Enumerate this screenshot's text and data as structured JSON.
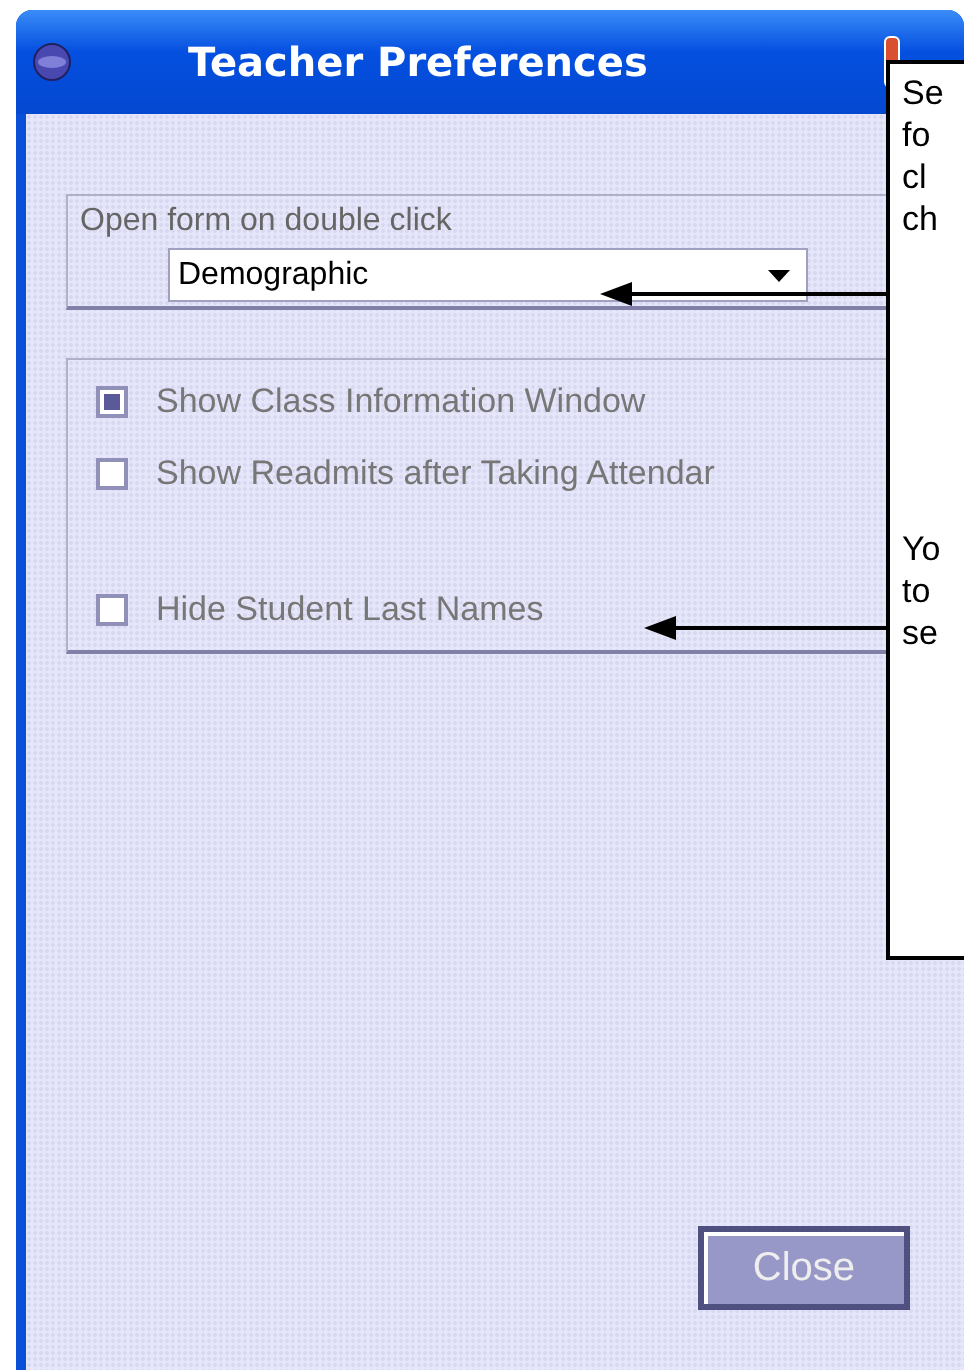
{
  "window": {
    "title": "Teacher Preferences"
  },
  "open_form": {
    "label": "Open form on double click",
    "value": "Demographic"
  },
  "options": [
    {
      "label": "Show Class Information Window",
      "checked": true
    },
    {
      "label": "Show Readmits after Taking Attendar",
      "checked": false
    },
    {
      "label": "Hide Student Last Names",
      "checked": false
    }
  ],
  "close_button": "Close",
  "callout": {
    "paragraphs": [
      [
        "Se",
        "fo",
        "cl",
        "ch"
      ],
      [
        "Yo",
        "to",
        "se"
      ]
    ]
  }
}
